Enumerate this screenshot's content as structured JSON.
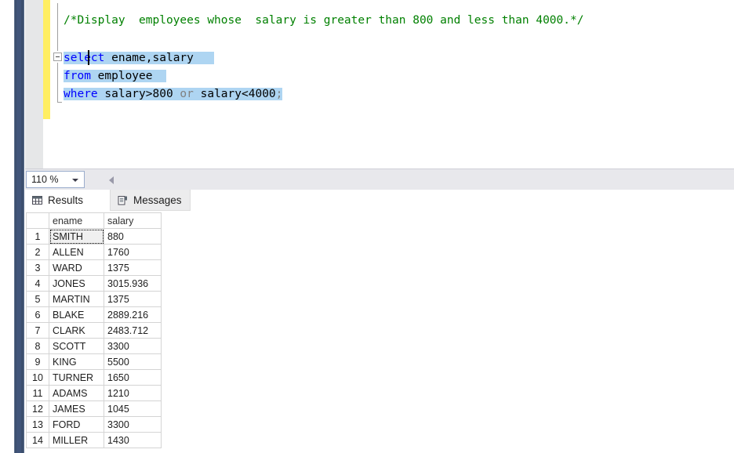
{
  "editor": {
    "zoom_level": "110 %",
    "lines": [
      {
        "id": "comment",
        "segments": [
          {
            "text": "/*Display  employees whose  salary is greater than 800 and less than 4000.*/",
            "kind": "cmt"
          }
        ]
      },
      {
        "id": "select",
        "segments": [
          {
            "text": "select",
            "kind": "kw"
          },
          {
            "text": " ename,salary",
            "kind": "plain"
          }
        ]
      },
      {
        "id": "from",
        "segments": [
          {
            "text": "from",
            "kind": "kw"
          },
          {
            "text": " employee",
            "kind": "plain"
          }
        ]
      },
      {
        "id": "where",
        "segments": [
          {
            "text": "where",
            "kind": "kw"
          },
          {
            "text": " salary>800 ",
            "kind": "plain"
          },
          {
            "text": "or",
            "kind": "op"
          },
          {
            "text": " salary<4000",
            "kind": "plain"
          },
          {
            "text": ";",
            "kind": "op"
          }
        ]
      }
    ],
    "line_text": {
      "comment": "/*Display  employees whose  salary is greater than 800 and less than 4000.*/",
      "select_kw": "select",
      "select_rest": " ename,salary",
      "from_kw": "from",
      "from_rest": " employee",
      "where_kw": "where",
      "where_cond1": " salary>800 ",
      "where_or": "or",
      "where_cond2": " salary<4000",
      "where_semicolon": ";"
    },
    "outline_collapse_icon": "minus-icon",
    "change_bar_color": "#ffee62",
    "selection_color": "#aed5f2"
  },
  "results": {
    "tabs": [
      {
        "id": "results",
        "label": "Results",
        "icon": "grid-icon",
        "active": true
      },
      {
        "id": "messages",
        "label": "Messages",
        "icon": "document-icon",
        "active": false
      }
    ],
    "tab_labels": {
      "results": "Results",
      "messages": "Messages"
    },
    "columns": [
      {
        "id": "rownum",
        "label": ""
      },
      {
        "id": "ename",
        "label": "ename"
      },
      {
        "id": "salary",
        "label": "salary"
      }
    ],
    "column_labels": {
      "rownum": "",
      "ename": "ename",
      "salary": "salary"
    },
    "rows": [
      {
        "n": "1",
        "ename": "SMITH",
        "salary": "880",
        "focused": true
      },
      {
        "n": "2",
        "ename": "ALLEN",
        "salary": "1760",
        "focused": false
      },
      {
        "n": "3",
        "ename": "WARD",
        "salary": "1375",
        "focused": false
      },
      {
        "n": "4",
        "ename": "JONES",
        "salary": "3015.936",
        "focused": false
      },
      {
        "n": "5",
        "ename": "MARTIN",
        "salary": "1375",
        "focused": false
      },
      {
        "n": "6",
        "ename": "BLAKE",
        "salary": "2889.216",
        "focused": false
      },
      {
        "n": "7",
        "ename": "CLARK",
        "salary": "2483.712",
        "focused": false
      },
      {
        "n": "8",
        "ename": "SCOTT",
        "salary": "3300",
        "focused": false
      },
      {
        "n": "9",
        "ename": "KING",
        "salary": "5500",
        "focused": false
      },
      {
        "n": "10",
        "ename": "TURNER",
        "salary": "1650",
        "focused": false
      },
      {
        "n": "11",
        "ename": "ADAMS",
        "salary": "1210",
        "focused": false
      },
      {
        "n": "12",
        "ename": "JAMES",
        "salary": "1045",
        "focused": false
      },
      {
        "n": "13",
        "ename": "FORD",
        "salary": "3300",
        "focused": false
      },
      {
        "n": "14",
        "ename": "MILLER",
        "salary": "1430",
        "focused": false
      }
    ],
    "row_count": 14
  },
  "chrome": {
    "hscroll_left_arrow_icon": "triangle-left-icon",
    "zoom_dropdown_icon": "chevron-down-icon",
    "dock_bar_color": "#3c4f6e"
  }
}
